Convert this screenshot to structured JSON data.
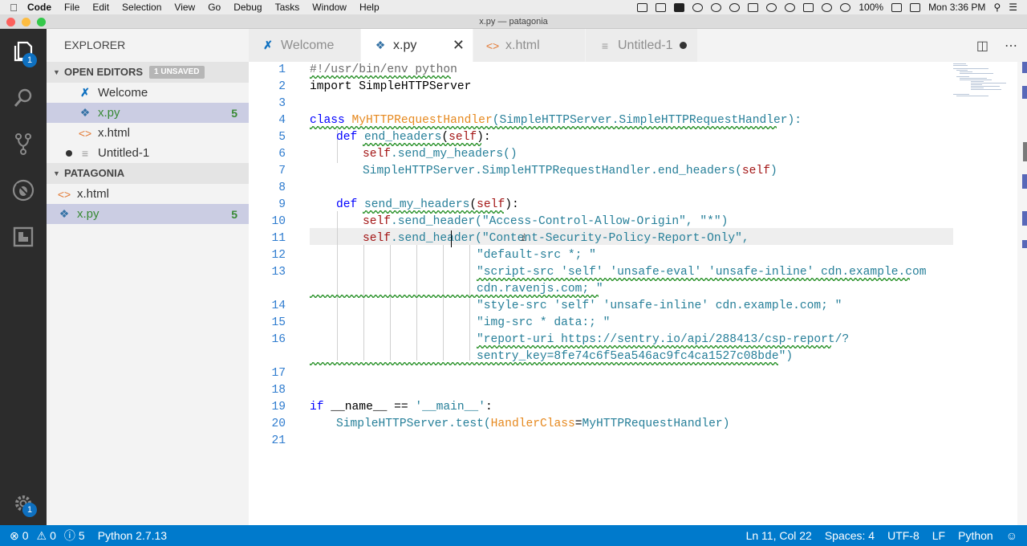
{
  "menubar": {
    "app": "Code",
    "items": [
      "File",
      "Edit",
      "Selection",
      "View",
      "Go",
      "Debug",
      "Tasks",
      "Window",
      "Help"
    ],
    "battery": "100%",
    "clock": "Mon 3:36 PM"
  },
  "window": {
    "title": "x.py — patagonia"
  },
  "activity": {
    "explorer_badge": "1",
    "settings_badge": "1"
  },
  "sidebar": {
    "title": "EXPLORER",
    "open_editors": {
      "label": "OPEN EDITORS",
      "badge": "1 UNSAVED",
      "items": [
        {
          "name": "Welcome",
          "icon": "vscode-icon"
        },
        {
          "name": "x.py",
          "icon": "python-icon",
          "count": "5"
        },
        {
          "name": "x.html",
          "icon": "html-icon"
        },
        {
          "name": "Untitled-1",
          "icon": "file-icon"
        }
      ]
    },
    "folder": {
      "label": "PATAGONIA",
      "items": [
        {
          "name": "x.html",
          "icon": "html-icon"
        },
        {
          "name": "x.py",
          "icon": "python-icon",
          "count": "5"
        }
      ]
    }
  },
  "tabs": [
    {
      "label": "Welcome"
    },
    {
      "label": "x.py"
    },
    {
      "label": "x.html"
    },
    {
      "label": "Untitled-1"
    }
  ],
  "editor": {
    "line_numbers": [
      "1",
      "2",
      "3",
      "4",
      "5",
      "6",
      "7",
      "8",
      "9",
      "10",
      "11",
      "12",
      "13",
      "14",
      "15",
      "16",
      "17",
      "18",
      "19",
      "20",
      "21"
    ],
    "lines": {
      "l1": "#!/usr/bin/env python",
      "l2": "import SimpleHTTPServer",
      "l4_kw": "class ",
      "l4_name": "MyHTTPRequestHandler",
      "l4_rest": "(SimpleHTTPServer.SimpleHTTPRequestHandler):",
      "l5_kw": "def ",
      "l5_name": "end_headers",
      "l5_self": "self",
      "l6_self": "self",
      "l6_rest": ".send_my_headers()",
      "l7_rest": "SimpleHTTPServer.SimpleHTTPRequestHandler.end_headers(",
      "l7_self": "self",
      "l9_kw": "def ",
      "l9_name": "send_my_headers",
      "l9_self": "self",
      "l10_self": "self",
      "l10_call": ".send_header(",
      "l10_str": "\"Access-Control-Allow-Origin\", \"*\"",
      "l11_self": "self",
      "l11_call": ".send_header(",
      "l11_str": "\"Content-Security-Policy-Report-Only\",",
      "l12_str": "\"default-src *; \"",
      "l13_str": "\"script-src 'self' 'unsafe-eval' 'unsafe-inline' cdn.example.com",
      "l13b_str": "cdn.ravenjs.com; \"",
      "l14_str": "\"style-src 'self' 'unsafe-inline' cdn.example.com; \"",
      "l15_str": "\"img-src * data:; \"",
      "l16_str": "\"report-uri https://sentry.io/api/288413/csp-report/?",
      "l16b_str": "sentry_key=8fe74c6f5ea546ac9fc4ca1527c08bde\")",
      "l19_kw": "if ",
      "l19_rest": "__name__ == ",
      "l19_str": "'__main__'",
      "l20_call": "SimpleHTTPServer.test(",
      "l20_param": "HandlerClass",
      "l20_arg": "MyHTTPRequestHandler"
    }
  },
  "status": {
    "errors": "0",
    "warnings": "0",
    "infos": "5",
    "interpreter": "Python 2.7.13",
    "position": "Ln 11, Col 22",
    "spaces": "Spaces: 4",
    "encoding": "UTF-8",
    "eol": "LF",
    "language": "Python"
  }
}
